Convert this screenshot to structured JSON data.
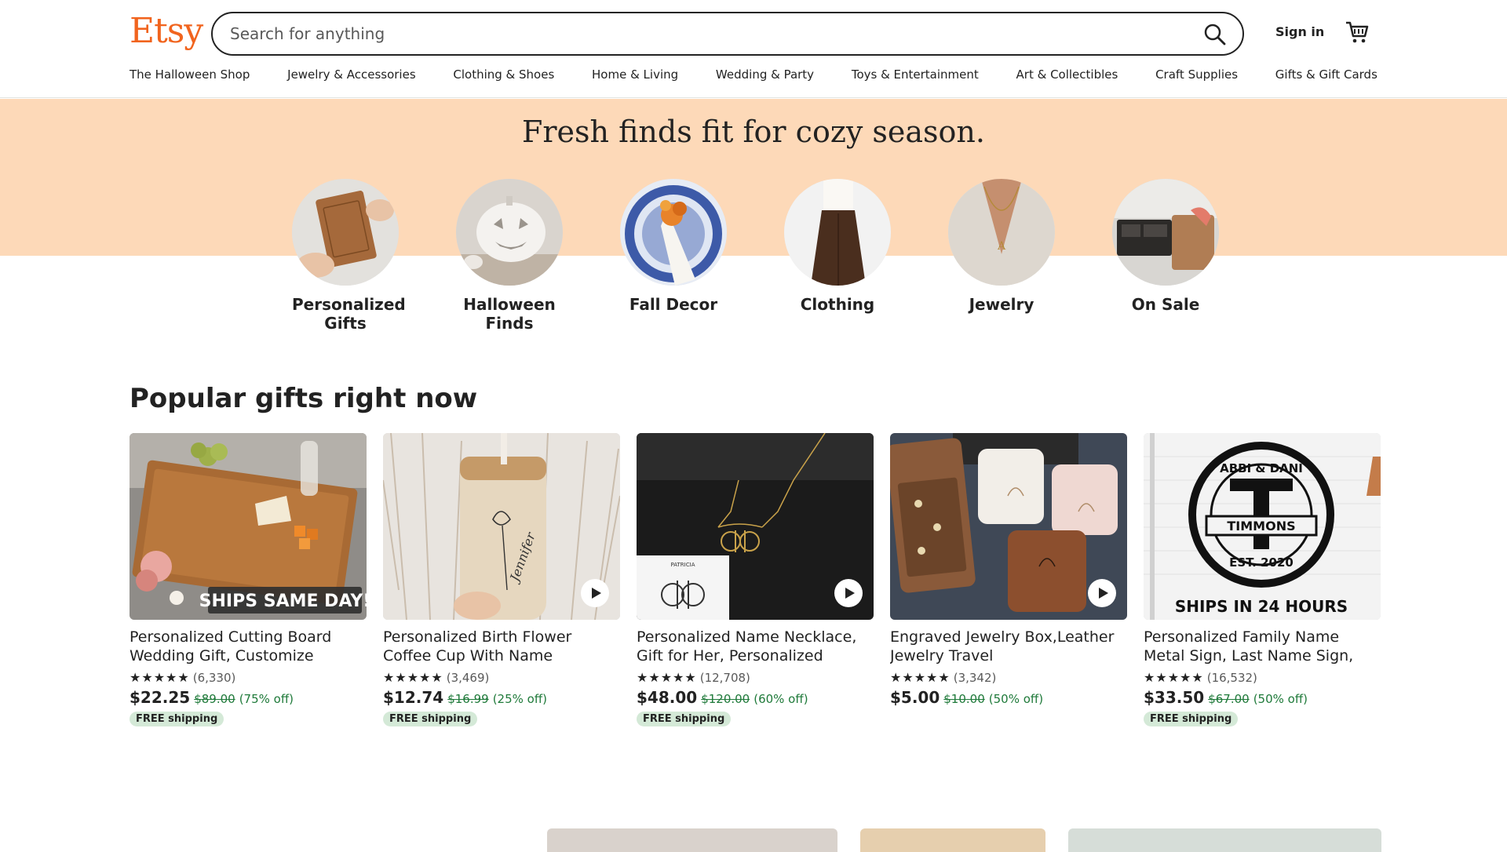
{
  "header": {
    "logo": "Etsy",
    "search_placeholder": "Search for anything",
    "sign_in": "Sign in"
  },
  "nav": [
    "The Halloween Shop",
    "Jewelry & Accessories",
    "Clothing & Shoes",
    "Home & Living",
    "Wedding & Party",
    "Toys & Entertainment",
    "Art & Collectibles",
    "Craft Supplies",
    "Gifts & Gift Cards"
  ],
  "hero": {
    "title": "Fresh finds fit for cozy season.",
    "categories": [
      {
        "label": "Personalized Gifts"
      },
      {
        "label": "Halloween Finds"
      },
      {
        "label": "Fall Decor"
      },
      {
        "label": "Clothing"
      },
      {
        "label": "Jewelry"
      },
      {
        "label": "On Sale"
      }
    ]
  },
  "popular": {
    "title": "Popular gifts right now",
    "items": [
      {
        "title": "Personalized Cutting Board Wedding Gift, Customize your…",
        "stars": "★★★★★",
        "reviews": "(6,330)",
        "price": "$22.25",
        "original": "$89.00",
        "discount": "(75% off)",
        "badge": "FREE shipping",
        "image_text": "SHIPS SAME DAY!",
        "has_video": false
      },
      {
        "title": "Personalized Birth Flower Coffee Cup With Name ,Personalized…",
        "stars": "★★★★★",
        "reviews": "(3,469)",
        "price": "$12.74",
        "original": "$16.99",
        "discount": "(25% off)",
        "badge": "FREE shipping",
        "image_text": "Jennifer",
        "has_video": true
      },
      {
        "title": "Personalized Name Necklace, Gift for Her, Personalized Gift,…",
        "stars": "★★★★★",
        "reviews": "(12,708)",
        "price": "$48.00",
        "original": "$120.00",
        "discount": "(60% off)",
        "badge": "FREE shipping",
        "image_text": "PATRICIA",
        "has_video": true
      },
      {
        "title": "Engraved Jewelry Box,Leather Jewelry Travel Case,Bridesmai…",
        "stars": "★★★★★",
        "reviews": "(3,342)",
        "price": "$5.00",
        "original": "$10.00",
        "discount": "(50% off)",
        "badge": "",
        "image_text": "",
        "has_video": true
      },
      {
        "title": "Personalized Family Name Metal Sign, Last Name Sign, Initial,…",
        "stars": "★★★★★",
        "reviews": "(16,532)",
        "price": "$33.50",
        "original": "$67.00",
        "discount": "(50% off)",
        "badge": "FREE shipping",
        "image_text": "SHIPS IN 24 HOURS",
        "sign_top": "ABBI & DANI",
        "sign_name": "TIMMONS",
        "sign_est": "EST. 2020",
        "has_video": false
      }
    ]
  },
  "colors": {
    "brand": "#f1641e",
    "hero_bg": "#fdd9b8",
    "free_shipping_bg": "#d4e9d7",
    "discount": "#1f7a3a"
  }
}
